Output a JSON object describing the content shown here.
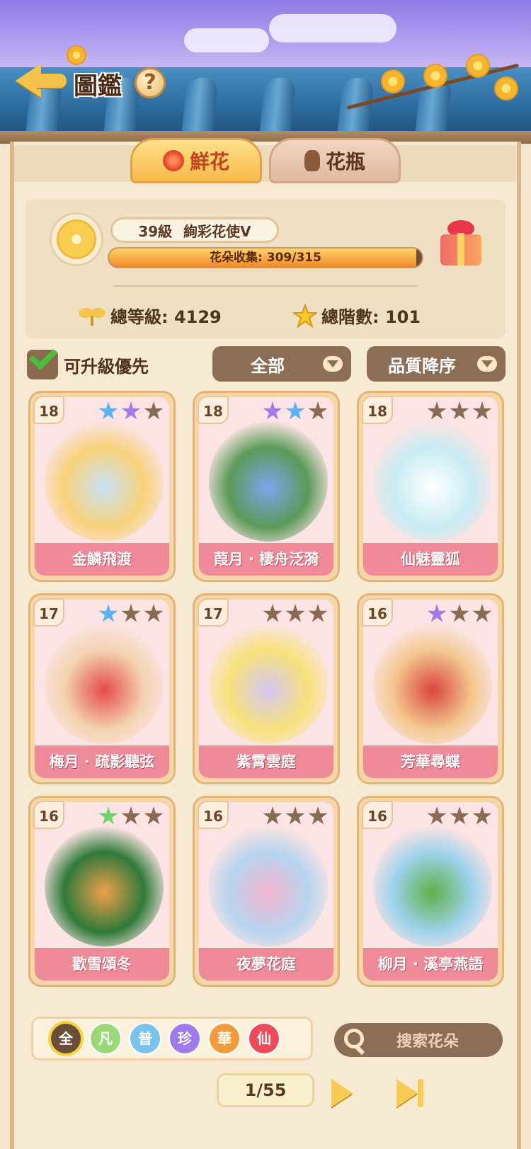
{
  "header": {
    "title": "圖鑑",
    "help": "?"
  },
  "tabs": [
    {
      "label": "鮮花",
      "active": true,
      "icon": "rose-icon"
    },
    {
      "label": "花瓶",
      "active": false,
      "icon": "vase-icon"
    }
  ],
  "summary": {
    "level": "39級",
    "rank": "絢彩花使Ⅴ",
    "collection_label": "花朵收集: 309/315",
    "collection_fraction": 0.981,
    "total_level": "總等級: 4129",
    "total_stars": "總階數: 101"
  },
  "filters": {
    "upgrade_first_label": "可升級優先",
    "upgrade_first_checked": true,
    "category": "全部",
    "sort": "品質降序"
  },
  "cards": [
    {
      "level": "18",
      "name": "金鱗飛渡",
      "stars": [
        "#5ab4f0",
        "#a17ae8",
        "#8a6a52"
      ],
      "art": [
        "#c9e3f6",
        "#f7d27a",
        "#fbe4e3"
      ]
    },
    {
      "level": "18",
      "name": "葭月 · 棲舟泛漪",
      "stars": [
        "#a17ae8",
        "#5ab4f0",
        "#8a6a52"
      ],
      "art": [
        "#7aa6ee",
        "#5a9a58",
        "#fbe4e3"
      ]
    },
    {
      "level": "18",
      "name": "仙魅靈狐",
      "stars": [
        "#8a6a52",
        "#8a6a52",
        "#8a6a52"
      ],
      "art": [
        "#ffffff",
        "#c8ecf3",
        "#fbe4e3"
      ]
    },
    {
      "level": "17",
      "name": "梅月 · 疏影聽弦",
      "stars": [
        "#5ab4f0",
        "#8a6a52",
        "#8a6a52"
      ],
      "art": [
        "#e44a4a",
        "#f3d3b0",
        "#fbe4e3"
      ]
    },
    {
      "level": "17",
      "name": "紫霄雲庭",
      "stars": [
        "#8a6a52",
        "#8a6a52",
        "#8a6a52"
      ],
      "art": [
        "#d4c6f4",
        "#f7e27a",
        "#fbe4e3"
      ]
    },
    {
      "level": "16",
      "name": "芳華尋蝶",
      "stars": [
        "#a17ae8",
        "#8a6a52",
        "#8a6a52"
      ],
      "art": [
        "#d9453e",
        "#f3c88f",
        "#fbe4e3"
      ]
    },
    {
      "level": "16",
      "name": "歡雪頌冬",
      "stars": [
        "#6fd26a",
        "#8a6a52",
        "#8a6a52"
      ],
      "art": [
        "#f0a04a",
        "#2f7a3a",
        "#fbe4e3"
      ]
    },
    {
      "level": "16",
      "name": "夜夢花庭",
      "stars": [
        "#8a6a52",
        "#8a6a52",
        "#8a6a52"
      ],
      "art": [
        "#f4b6cf",
        "#b6d4ee",
        "#fbe4e3"
      ]
    },
    {
      "level": "16",
      "name": "柳月 · 溪亭燕語",
      "stars": [
        "#8a6a52",
        "#8a6a52",
        "#8a6a52"
      ],
      "art": [
        "#5fb048",
        "#9ed3ec",
        "#fbe4e3"
      ]
    }
  ],
  "quality_chips": [
    {
      "label": "全",
      "color": "#6a4e3a",
      "selected": true
    },
    {
      "label": "凡",
      "color": "#9ad87a",
      "selected": false
    },
    {
      "label": "普",
      "color": "#79c3ee",
      "selected": false
    },
    {
      "label": "珍",
      "color": "#a07ae8",
      "selected": false
    },
    {
      "label": "華",
      "color": "#f39a3a",
      "selected": false
    },
    {
      "label": "仙",
      "color": "#ee4a5a",
      "selected": false
    }
  ],
  "search": {
    "placeholder": "搜索花朵"
  },
  "pagination": {
    "label": "1/55"
  }
}
